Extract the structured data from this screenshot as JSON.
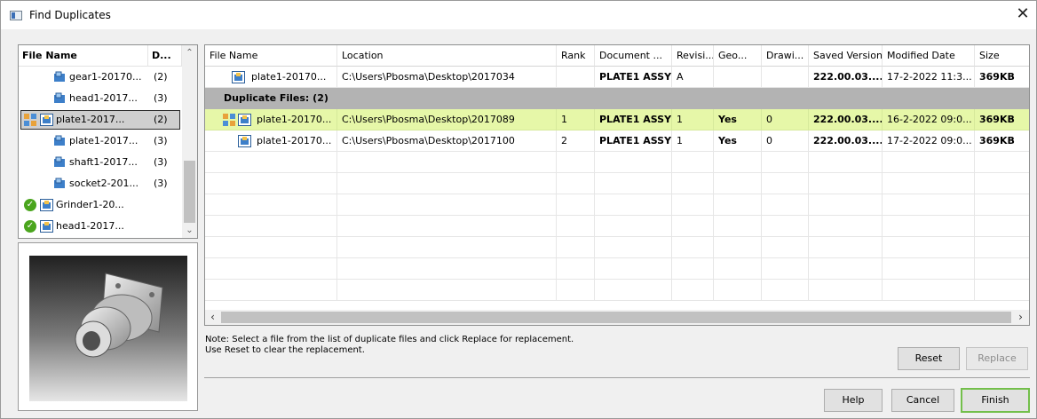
{
  "window": {
    "title": "Find Duplicates",
    "close_icon": "close-icon"
  },
  "left_list": {
    "columns": [
      "File Name",
      "D..."
    ],
    "rows": [
      {
        "name": "gear1-20170...",
        "count": "(2)",
        "icon": "part-icon",
        "status": ""
      },
      {
        "name": "head1-2017...",
        "count": "(3)",
        "icon": "part-icon",
        "status": ""
      },
      {
        "name": "plate1-2017...",
        "count": "(2)",
        "icon": "assembly-icon",
        "status": "replace",
        "selected": true
      },
      {
        "name": "plate1-2017...",
        "count": "(3)",
        "icon": "part-icon",
        "status": ""
      },
      {
        "name": "shaft1-2017...",
        "count": "(3)",
        "icon": "part-icon",
        "status": ""
      },
      {
        "name": "socket2-201...",
        "count": "(3)",
        "icon": "part-icon",
        "status": ""
      },
      {
        "name": "Grinder1-20...",
        "count": "",
        "icon": "assembly-icon",
        "status": "done"
      },
      {
        "name": "head1-2017...",
        "count": "",
        "icon": "assembly-icon",
        "status": "done"
      }
    ]
  },
  "grid": {
    "columns": [
      "File Name",
      "Location",
      "Rank",
      "Document ...",
      "Revisi...",
      "Geo...",
      "Drawi...",
      "Saved Version",
      "Modified Date",
      "Size"
    ],
    "original_row": {
      "file_name": "plate1-20170...",
      "location": "C:\\Users\\Pbosma\\Desktop\\2017034",
      "rank": "",
      "document": "PLATE1 ASSY",
      "revision": "A",
      "geometry": "",
      "drawing": "",
      "saved_version": "222.00.03....",
      "modified_date": "17-2-2022 11:3...",
      "size": "369KB"
    },
    "group_label": "Duplicate Files: (2)",
    "duplicate_rows": [
      {
        "file_name": "plate1-20170...",
        "location": "C:\\Users\\Pbosma\\Desktop\\2017089",
        "rank": "1",
        "document": "PLATE1 ASSY",
        "revision": "1",
        "geometry": "Yes",
        "drawing": "0",
        "saved_version": "222.00.03....",
        "modified_date": "16-2-2022 09:0...",
        "size": "369KB"
      },
      {
        "file_name": "plate1-20170...",
        "location": "C:\\Users\\Pbosma\\Desktop\\2017100",
        "rank": "2",
        "document": "PLATE1 ASSY",
        "revision": "1",
        "geometry": "Yes",
        "drawing": "0",
        "saved_version": "222.00.03....",
        "modified_date": "17-2-2022 09:0...",
        "size": "369KB"
      }
    ]
  },
  "note": {
    "line1": "Note: Select a file from the list of duplicate files and click Replace for replacement.",
    "line2": "Use Reset to clear the replacement."
  },
  "buttons": {
    "reset": "Reset",
    "replace": "Replace",
    "help": "Help",
    "cancel": "Cancel",
    "finish": "Finish"
  },
  "colors": {
    "highlight_row": "#e6f7a8",
    "group_header": "#b3b3b3",
    "finish_border": "#73bf4b"
  }
}
